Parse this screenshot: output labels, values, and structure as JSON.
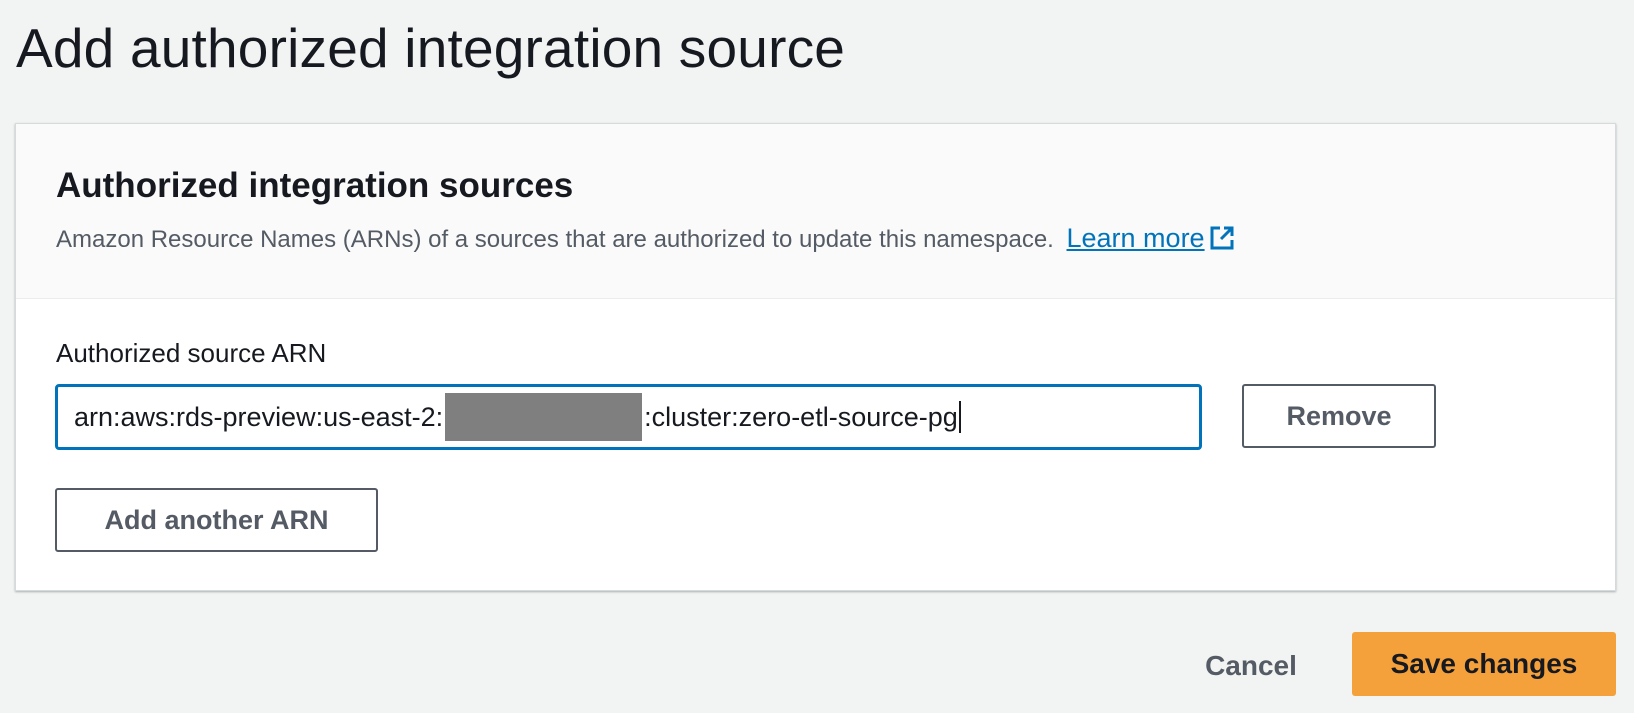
{
  "page": {
    "title": "Add authorized integration source"
  },
  "panel": {
    "title": "Authorized integration sources",
    "description": "Amazon Resource Names (ARNs) of a sources that are authorized to update this namespace.",
    "learn_more": "Learn more",
    "learn_more_icon": "external-link-icon"
  },
  "form": {
    "field_label": "Authorized source ARN",
    "arn_prefix": "arn:aws:rds-preview:us-east-2:",
    "arn_suffix": ":cluster:zero-etl-source-pg",
    "remove_label": "Remove",
    "add_another_label": "Add another ARN"
  },
  "footer": {
    "cancel_label": "Cancel",
    "save_label": "Save changes"
  },
  "colors": {
    "page_background": "#f2f3f3",
    "link": "#0073bb",
    "input_focus_border": "#0073bb",
    "primary_button": "#f5a13b",
    "secondary_text": "#545b64"
  }
}
